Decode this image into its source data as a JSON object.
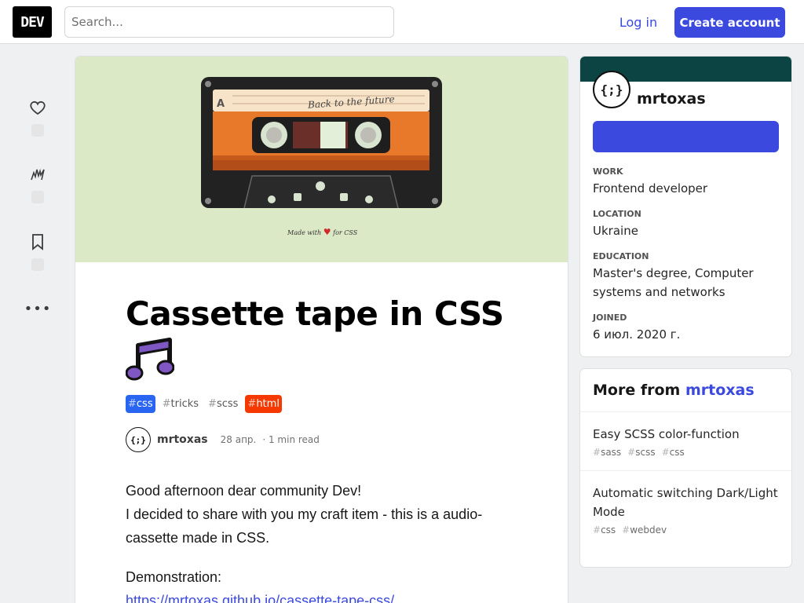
{
  "header": {
    "logo": "DEV",
    "search_placeholder": "Search...",
    "login": "Log in",
    "create_account": "Create account"
  },
  "article": {
    "cover": {
      "cassette_side": "A",
      "cassette_label": "Back to the future",
      "made_with_prefix": "Made with",
      "made_with_suffix": "for CSS"
    },
    "title": "Cassette tape in CSS",
    "title_emoji": "music-note-icon",
    "tags": [
      {
        "name": "css",
        "color": "#2965f1"
      },
      {
        "name": "tricks",
        "color": ""
      },
      {
        "name": "scss",
        "color": ""
      },
      {
        "name": "html",
        "color": "#f53900"
      }
    ],
    "author": "mrtoxas",
    "avatar_text": "{;}",
    "date": "28 апр.",
    "read_time": "1 min read",
    "paragraphs": [
      "Good afternoon dear community Dev!",
      "I decided to share with you my craft item - this is a audio-cassette made in CSS."
    ],
    "demo_label": "Demonstration:",
    "demo_link": "https://mrtoxas.github.io/cassette-tape-css/"
  },
  "profile": {
    "avatar_text": "{;}",
    "name": "mrtoxas",
    "brand_color": "#0c4444",
    "fields": [
      {
        "label": "Work",
        "value": "Frontend developer"
      },
      {
        "label": "Location",
        "value": "Ukraine"
      },
      {
        "label": "Education",
        "value": "Master's degree, Computer systems and networks"
      },
      {
        "label": "Joined",
        "value": "6 июл. 2020 г."
      }
    ]
  },
  "more_from": {
    "heading": "More from",
    "author": "mrtoxas",
    "items": [
      {
        "title": "Easy SCSS color-function",
        "tags": [
          "sass",
          "scss",
          "css"
        ]
      },
      {
        "title": "Automatic switching Dark/Light Mode",
        "tags": [
          "css",
          "webdev"
        ]
      }
    ]
  }
}
